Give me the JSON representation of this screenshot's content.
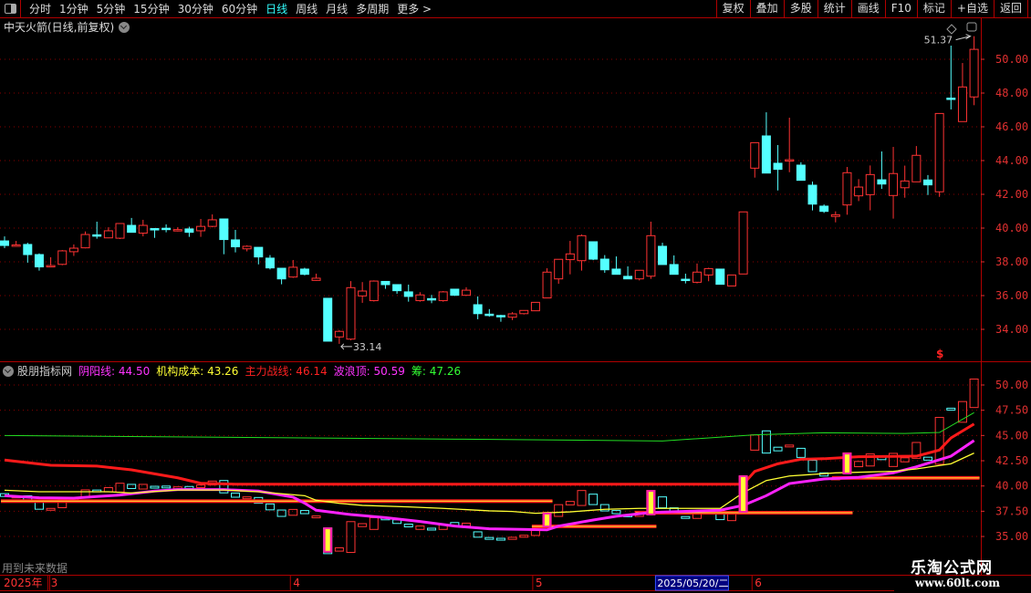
{
  "toolbar": {
    "left_items": [
      {
        "label": "分时"
      },
      {
        "label": "1分钟"
      },
      {
        "label": "5分钟"
      },
      {
        "label": "15分钟"
      },
      {
        "label": "30分钟"
      },
      {
        "label": "60分钟"
      },
      {
        "label": "日线",
        "active": true
      },
      {
        "label": "周线"
      },
      {
        "label": "月线"
      },
      {
        "label": "多周期"
      },
      {
        "label": "更多 >"
      }
    ],
    "right_buttons": [
      {
        "label": "复权"
      },
      {
        "label": "叠加"
      },
      {
        "label": "多股"
      },
      {
        "label": "统计"
      },
      {
        "label": "画线"
      },
      {
        "label": "F10"
      },
      {
        "label": "标记"
      },
      {
        "label": "+自选"
      },
      {
        "label": "返回"
      }
    ]
  },
  "main_title": "中天火箭(日线,前复权)",
  "indicator": {
    "name": "股朋指标网",
    "values": [
      {
        "label": "阴阳线:",
        "value": "44.50",
        "color": "#ff33ff"
      },
      {
        "label": "机构成本:",
        "value": "43.26",
        "color": "#ffff33"
      },
      {
        "label": "主力战线:",
        "value": "46.14",
        "color": "#ff2222"
      },
      {
        "label": "波浪顶:",
        "value": "50.59",
        "color": "#ff33ff"
      },
      {
        "label": "筹:",
        "value": "47.26",
        "color": "#33ff33"
      }
    ]
  },
  "future_note": "用到未来数据",
  "watermark": {
    "name": "乐淘公式网",
    "url": "www.60lt.com"
  },
  "timeline": {
    "year": "2025年",
    "cursor_date": "2025/05/20/二"
  },
  "colors": {
    "up": "#ff3333",
    "down": "#54ffff",
    "grid": "#8a0000",
    "axis": "#e03030"
  },
  "chart_data": [
    {
      "type": "candlestick",
      "title": "中天火箭(日线,前复权)",
      "ylim": [
        33,
        51.5
      ],
      "yticks": [
        "34.00",
        "36.00",
        "38.00",
        "40.00",
        "42.00",
        "44.00",
        "46.00",
        "48.00",
        "50.00"
      ],
      "grid": true,
      "annotations": {
        "high": "51.37",
        "low": "33.14"
      },
      "columns": [
        "date",
        "open",
        "high",
        "low",
        "close"
      ],
      "candles": [
        [
          "2025-02-25",
          39.24,
          39.51,
          38.81,
          38.97
        ],
        [
          "2025-02-26",
          38.97,
          39.24,
          38.95,
          39.0
        ],
        [
          "2025-02-27",
          39.03,
          39.13,
          37.95,
          38.43
        ],
        [
          "2025-02-28",
          38.43,
          38.5,
          37.48,
          37.7
        ],
        [
          "2025-03-03",
          37.72,
          38.27,
          37.68,
          37.78
        ],
        [
          "2025-03-04",
          37.85,
          38.7,
          37.8,
          38.65
        ],
        [
          "2025-03-05",
          38.6,
          39.03,
          38.35,
          38.81
        ],
        [
          "2025-03-06",
          38.83,
          39.8,
          38.8,
          39.62
        ],
        [
          "2025-03-07",
          39.6,
          40.38,
          39.37,
          39.55
        ],
        [
          "2025-03-10",
          39.42,
          40.05,
          39.4,
          39.84
        ],
        [
          "2025-03-11",
          39.4,
          40.3,
          39.35,
          40.27
        ],
        [
          "2025-03-12",
          40.16,
          40.6,
          39.75,
          39.75
        ],
        [
          "2025-03-13",
          39.7,
          40.49,
          39.51,
          40.16
        ],
        [
          "2025-03-14",
          39.97,
          40.0,
          39.42,
          39.94
        ],
        [
          "2025-03-17",
          39.99,
          40.22,
          39.75,
          39.97
        ],
        [
          "2025-03-18",
          39.89,
          40.05,
          39.8,
          39.91
        ],
        [
          "2025-03-19",
          39.95,
          40.08,
          39.48,
          39.75
        ],
        [
          "2025-03-20",
          39.84,
          40.54,
          39.48,
          40.1
        ],
        [
          "2025-03-21",
          40.1,
          40.81,
          40.05,
          40.49
        ],
        [
          "2025-03-24",
          40.54,
          40.54,
          38.45,
          39.32
        ],
        [
          "2025-03-25",
          39.3,
          39.89,
          38.56,
          38.89
        ],
        [
          "2025-03-26",
          38.77,
          38.98,
          38.62,
          38.92
        ],
        [
          "2025-03-27",
          38.86,
          38.86,
          37.85,
          38.29
        ],
        [
          "2025-03-28",
          38.22,
          38.4,
          37.55,
          37.64
        ],
        [
          "2025-03-31",
          37.62,
          37.62,
          36.67,
          36.99
        ],
        [
          "2025-04-01",
          37.1,
          38.11,
          37.05,
          37.68
        ],
        [
          "2025-04-02",
          37.57,
          37.65,
          37.2,
          37.26
        ],
        [
          "2025-04-03",
          36.9,
          37.3,
          36.88,
          37.03
        ],
        [
          "2025-04-07",
          35.84,
          35.84,
          33.3,
          33.3
        ],
        [
          "2025-04-08",
          33.55,
          33.95,
          33.14,
          33.88
        ],
        [
          "2025-04-09",
          33.42,
          36.86,
          33.35,
          36.47
        ],
        [
          "2025-04-10",
          35.98,
          36.8,
          35.57,
          36.27
        ],
        [
          "2025-04-11",
          35.7,
          36.9,
          35.65,
          36.86
        ],
        [
          "2025-04-14",
          36.84,
          36.84,
          36.4,
          36.65
        ],
        [
          "2025-04-15",
          36.65,
          36.65,
          36.11,
          36.29
        ],
        [
          "2025-04-16",
          36.22,
          36.65,
          35.64,
          35.95
        ],
        [
          "2025-04-17",
          35.7,
          36.2,
          35.64,
          36.04
        ],
        [
          "2025-04-18",
          35.82,
          36.04,
          35.55,
          35.78
        ],
        [
          "2025-04-21",
          35.7,
          36.27,
          35.64,
          36.22
        ],
        [
          "2025-04-22",
          36.38,
          36.38,
          35.98,
          36.02
        ],
        [
          "2025-04-23",
          36.02,
          36.49,
          35.98,
          36.32
        ],
        [
          "2025-04-24",
          35.46,
          35.95,
          34.6,
          34.93
        ],
        [
          "2025-04-25",
          34.9,
          35.2,
          34.75,
          34.86
        ],
        [
          "2025-04-28",
          34.82,
          34.86,
          34.45,
          34.78
        ],
        [
          "2025-04-29",
          34.72,
          35.02,
          34.55,
          34.92
        ],
        [
          "2025-04-30",
          34.93,
          35.12,
          34.88,
          35.12
        ],
        [
          "2025-05-06",
          35.1,
          35.6,
          35.1,
          35.6
        ],
        [
          "2025-05-07",
          35.86,
          37.62,
          35.86,
          37.39
        ],
        [
          "2025-05-08",
          36.99,
          38.15,
          36.7,
          38.15
        ],
        [
          "2025-05-09",
          38.13,
          39.24,
          37.26,
          38.47
        ],
        [
          "2025-05-12",
          38.07,
          39.62,
          37.48,
          39.55
        ],
        [
          "2025-05-13",
          39.19,
          39.19,
          38.1,
          38.16
        ],
        [
          "2025-05-14",
          38.16,
          38.4,
          37.35,
          37.53
        ],
        [
          "2025-05-15",
          37.57,
          38.32,
          37.26,
          37.26
        ],
        [
          "2025-05-16",
          37.14,
          37.73,
          36.99,
          36.99
        ],
        [
          "2025-05-19",
          36.99,
          37.5,
          36.9,
          37.5
        ],
        [
          "2025-05-20",
          37.15,
          40.38,
          36.99,
          39.55
        ],
        [
          "2025-05-21",
          38.92,
          39.13,
          37.84,
          37.84
        ],
        [
          "2025-05-22",
          37.84,
          38.38,
          37.26,
          37.26
        ],
        [
          "2025-05-23",
          36.97,
          37.3,
          36.72,
          36.95
        ],
        [
          "2025-05-26",
          36.79,
          37.9,
          36.72,
          37.39
        ],
        [
          "2025-05-27",
          37.22,
          37.65,
          36.85,
          37.6
        ],
        [
          "2025-05-28",
          37.57,
          37.57,
          36.67,
          36.67
        ],
        [
          "2025-05-29",
          36.57,
          37.22,
          36.57,
          37.22
        ],
        [
          "2025-05-30",
          37.28,
          40.96,
          37.28,
          40.96
        ],
        [
          "2025-06-03",
          43.55,
          45.06,
          42.99,
          45.06
        ],
        [
          "2025-06-04",
          45.46,
          46.86,
          43.26,
          43.26
        ],
        [
          "2025-06-05",
          43.84,
          44.92,
          42.23,
          43.48
        ],
        [
          "2025-06-06",
          44.0,
          46.54,
          43.31,
          44.05
        ],
        [
          "2025-06-09",
          43.73,
          43.9,
          42.83,
          42.83
        ],
        [
          "2025-06-10",
          42.54,
          42.76,
          41.05,
          41.42
        ],
        [
          "2025-06-11",
          41.3,
          41.4,
          40.9,
          40.99
        ],
        [
          "2025-06-12",
          40.69,
          40.99,
          40.34,
          40.79
        ],
        [
          "2025-06-13",
          41.37,
          43.62,
          40.79,
          43.28
        ],
        [
          "2025-06-16",
          41.91,
          42.9,
          41.6,
          42.43
        ],
        [
          "2025-06-17",
          41.98,
          43.71,
          41.05,
          43.17
        ],
        [
          "2025-06-18",
          42.86,
          44.54,
          42.32,
          42.61
        ],
        [
          "2025-06-19",
          41.93,
          44.81,
          40.56,
          43.23
        ],
        [
          "2025-06-20",
          42.39,
          43.7,
          41.8,
          42.79
        ],
        [
          "2025-06-23",
          42.74,
          44.86,
          42.74,
          44.31
        ],
        [
          "2025-06-24",
          42.85,
          43.14,
          41.96,
          42.56
        ],
        [
          "2025-06-25",
          42.15,
          46.79,
          41.85,
          46.79
        ],
        [
          "2025-06-26",
          47.7,
          50.81,
          47.03,
          47.62
        ],
        [
          "2025-06-27",
          46.31,
          49.78,
          46.31,
          48.36
        ],
        [
          "2025-06-30",
          47.77,
          51.37,
          47.28,
          50.59
        ]
      ]
    },
    {
      "type": "line",
      "title": "股朋指标网",
      "ylim": [
        33.5,
        51.2
      ],
      "yticks": [
        "35.00",
        "37.50",
        "40.00",
        "42.50",
        "45.00",
        "47.50",
        "50.00"
      ],
      "grid": true,
      "series": [
        {
          "name": "筹",
          "color": "#22dd22",
          "points": [
            [
              "2025-02-25",
              45.0
            ],
            [
              "2025-04-22",
              44.64
            ],
            [
              "2025-05-21",
              44.46
            ],
            [
              "2025-06-03",
              45.06
            ],
            [
              "2025-06-11",
              45.27
            ],
            [
              "2025-06-20",
              45.2
            ],
            [
              "2025-06-25",
              45.3
            ],
            [
              "2025-06-30",
              47.26
            ]
          ]
        },
        {
          "name": "主力战线",
          "color": "#ff1a1a",
          "points": [
            [
              "2025-02-25",
              42.57
            ],
            [
              "2025-03-03",
              42.05
            ],
            [
              "2025-03-07",
              41.97
            ],
            [
              "2025-03-12",
              41.6
            ],
            [
              "2025-03-18",
              40.81
            ],
            [
              "2025-03-20",
              40.27
            ],
            [
              "2025-03-25",
              40.18
            ],
            [
              "2025-05-30",
              40.18
            ],
            [
              "2025-06-03",
              41.45
            ],
            [
              "2025-06-05",
              42.2
            ],
            [
              "2025-06-09",
              42.65
            ],
            [
              "2025-06-11",
              42.7
            ],
            [
              "2025-06-16",
              42.9
            ],
            [
              "2025-06-23",
              42.95
            ],
            [
              "2025-06-25",
              43.56
            ],
            [
              "2025-06-26",
              44.76
            ],
            [
              "2025-06-30",
              46.14
            ]
          ]
        },
        {
          "name": "阴阳线",
          "color": "#ff22ff",
          "points": [
            [
              "2025-02-25",
              39.04
            ],
            [
              "2025-02-28",
              38.83
            ],
            [
              "2025-03-05",
              38.8
            ],
            [
              "2025-03-07",
              38.96
            ],
            [
              "2025-03-11",
              39.1
            ],
            [
              "2025-03-14",
              39.5
            ],
            [
              "2025-03-18",
              39.64
            ],
            [
              "2025-03-24",
              39.64
            ],
            [
              "2025-03-27",
              39.5
            ],
            [
              "2025-04-01",
              38.9
            ],
            [
              "2025-04-02",
              38.3
            ],
            [
              "2025-04-03",
              37.6
            ],
            [
              "2025-04-09",
              37.17
            ],
            [
              "2025-04-14",
              36.87
            ],
            [
              "2025-04-17",
              36.48
            ],
            [
              "2025-04-22",
              36.03
            ],
            [
              "2025-04-25",
              35.76
            ],
            [
              "2025-05-07",
              35.66
            ],
            [
              "2025-05-08",
              36.03
            ],
            [
              "2025-05-13",
              36.63
            ],
            [
              "2025-05-15",
              37.0
            ],
            [
              "2025-05-20",
              37.38
            ],
            [
              "2025-05-28",
              37.6
            ],
            [
              "2025-05-30",
              38.08
            ],
            [
              "2025-06-04",
              39.04
            ],
            [
              "2025-06-06",
              40.24
            ],
            [
              "2025-06-11",
              40.7
            ],
            [
              "2025-06-16",
              40.85
            ],
            [
              "2025-06-19",
              41.3
            ],
            [
              "2025-06-23",
              41.9
            ],
            [
              "2025-06-26",
              42.95
            ],
            [
              "2025-06-30",
              44.5
            ]
          ]
        },
        {
          "name": "机构成本",
          "color": "#ffff33",
          "points": [
            [
              "2025-02-25",
              39.58
            ],
            [
              "2025-02-28",
              39.43
            ],
            [
              "2025-03-10",
              39.43
            ],
            [
              "2025-03-12",
              39.3
            ],
            [
              "2025-03-18",
              39.6
            ],
            [
              "2025-03-24",
              39.6
            ],
            [
              "2025-03-27",
              39.43
            ],
            [
              "2025-04-02",
              39.04
            ],
            [
              "2025-04-03",
              38.59
            ],
            [
              "2025-04-08",
              38.28
            ],
            [
              "2025-04-10",
              38.08
            ],
            [
              "2025-04-16",
              37.93
            ],
            [
              "2025-04-21",
              37.78
            ],
            [
              "2025-04-25",
              37.54
            ],
            [
              "2025-04-29",
              37.48
            ],
            [
              "2025-05-06",
              37.3
            ],
            [
              "2025-05-09",
              37.44
            ],
            [
              "2025-05-14",
              37.69
            ],
            [
              "2025-05-19",
              37.78
            ],
            [
              "2025-05-28",
              37.78
            ],
            [
              "2025-05-30",
              39.34
            ],
            [
              "2025-06-04",
              40.54
            ],
            [
              "2025-06-06",
              40.99
            ],
            [
              "2025-06-12",
              41.3
            ],
            [
              "2025-06-19",
              41.45
            ],
            [
              "2025-06-23",
              41.69
            ],
            [
              "2025-06-26",
              42.2
            ],
            [
              "2025-06-30",
              43.26
            ]
          ]
        }
      ],
      "levels": [
        [
          "2025-02-25",
          "2025-05-07",
          38.5
        ],
        [
          "2025-05-06",
          "2025-05-20",
          36.0
        ],
        [
          "2025-05-19",
          "2025-06-13",
          37.35
        ],
        [
          "2025-06-12",
          "2025-06-30",
          40.8
        ]
      ],
      "signals": [
        [
          "2025-04-07",
          33.4,
          35.9
        ],
        [
          "2025-05-07",
          35.9,
          37.35
        ],
        [
          "2025-05-20",
          37.1,
          39.6
        ],
        [
          "2025-05-30",
          37.35,
          41.06
        ],
        [
          "2025-06-13",
          41.15,
          43.3
        ]
      ]
    }
  ]
}
